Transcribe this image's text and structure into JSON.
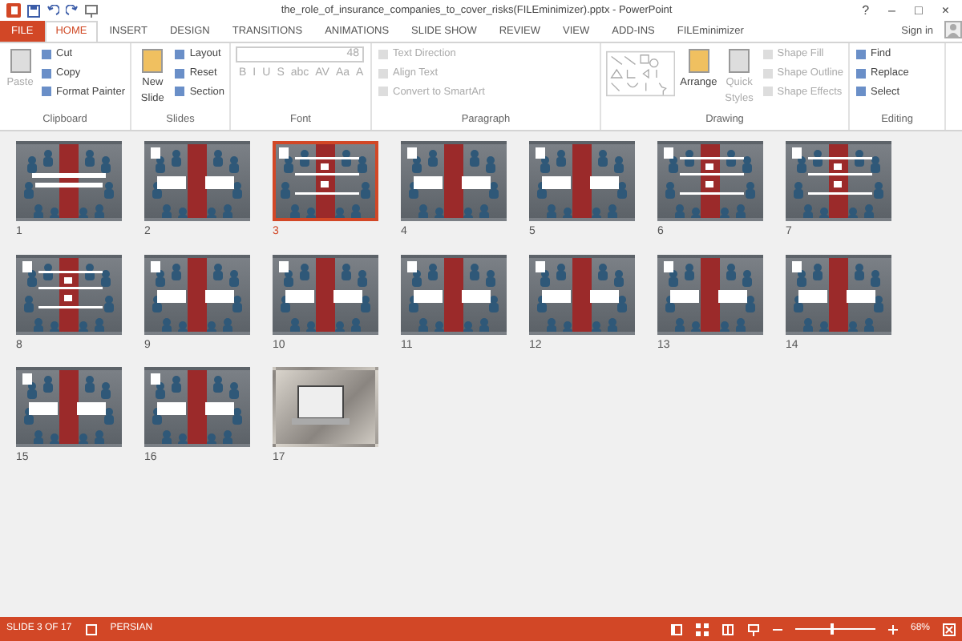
{
  "window": {
    "title": "the_role_of_insurance_companies_to_cover_risks(FILEminimizer).pptx - PowerPoint",
    "controls": [
      "?",
      "–",
      "□",
      "×"
    ]
  },
  "tabs": [
    {
      "label": "FILE",
      "kind": "file",
      "selected": false
    },
    {
      "label": "HOME",
      "kind": "tab",
      "selected": true
    },
    {
      "label": "INSERT",
      "kind": "tab",
      "selected": false
    },
    {
      "label": "DESIGN",
      "kind": "tab",
      "selected": false
    },
    {
      "label": "TRANSITIONS",
      "kind": "tab",
      "selected": false
    },
    {
      "label": "ANIMATIONS",
      "kind": "tab",
      "selected": false
    },
    {
      "label": "SLIDE SHOW",
      "kind": "tab",
      "selected": false
    },
    {
      "label": "REVIEW",
      "kind": "tab",
      "selected": false
    },
    {
      "label": "VIEW",
      "kind": "tab",
      "selected": false
    },
    {
      "label": "ADD-INS",
      "kind": "tab",
      "selected": false
    },
    {
      "label": "FILEminimizer",
      "kind": "tab",
      "selected": false
    }
  ],
  "sign_in": "Sign in",
  "ribbon": [
    {
      "label": "Clipboard",
      "items": [
        {
          "label": "Paste",
          "kind": "large",
          "disabled": true
        },
        {
          "label": "Cut",
          "kind": "small",
          "disabled": false
        },
        {
          "label": "Copy",
          "kind": "small",
          "disabled": false
        },
        {
          "label": "Format Painter",
          "kind": "small",
          "disabled": false
        }
      ]
    },
    {
      "label": "Slides",
      "items": [
        {
          "label": "New Slide",
          "kind": "large",
          "disabled": false
        },
        {
          "label": "Layout",
          "kind": "small",
          "disabled": false
        },
        {
          "label": "Reset",
          "kind": "small",
          "disabled": false
        },
        {
          "label": "Section",
          "kind": "small",
          "disabled": false
        }
      ]
    },
    {
      "label": "Font",
      "items": [
        {
          "label": "48",
          "kind": "fontsize",
          "disabled": true
        },
        {
          "label": "B",
          "kind": "glyph",
          "disabled": true
        },
        {
          "label": "I",
          "kind": "glyph",
          "disabled": true
        },
        {
          "label": "U",
          "kind": "glyph",
          "disabled": true
        },
        {
          "label": "S",
          "kind": "glyph",
          "disabled": true
        },
        {
          "label": "abc",
          "kind": "glyph",
          "disabled": true
        },
        {
          "label": "AV",
          "kind": "glyph",
          "disabled": true
        },
        {
          "label": "Aa",
          "kind": "glyph",
          "disabled": true
        },
        {
          "label": "A",
          "kind": "glyph",
          "disabled": true
        }
      ]
    },
    {
      "label": "Paragraph",
      "items": [
        {
          "label": "Text Direction",
          "kind": "small",
          "disabled": true
        },
        {
          "label": "Align Text",
          "kind": "small",
          "disabled": true
        },
        {
          "label": "Convert to SmartArt",
          "kind": "small",
          "disabled": true
        }
      ]
    },
    {
      "label": "Drawing",
      "items": [
        {
          "kind": "gallery",
          "disabled": true
        },
        {
          "label": "Arrange",
          "kind": "large",
          "disabled": false
        },
        {
          "label": "Quick Styles",
          "kind": "large",
          "disabled": true
        },
        {
          "label": "Shape Fill",
          "kind": "small",
          "disabled": true
        },
        {
          "label": "Shape Outline",
          "kind": "small",
          "disabled": true
        },
        {
          "label": "Shape Effects",
          "kind": "small",
          "disabled": true
        }
      ]
    },
    {
      "label": "Editing",
      "items": [
        {
          "label": "Find",
          "kind": "small",
          "disabled": false
        },
        {
          "label": "Replace",
          "kind": "small",
          "disabled": false
        },
        {
          "label": "Select",
          "kind": "small",
          "disabled": false
        }
      ]
    }
  ],
  "slides": [
    {
      "number": "1",
      "kind": "title",
      "selected": false
    },
    {
      "number": "2",
      "kind": "boxes",
      "selected": false
    },
    {
      "number": "3",
      "kind": "text",
      "selected": true
    },
    {
      "number": "4",
      "kind": "boxes",
      "selected": false
    },
    {
      "number": "5",
      "kind": "boxes",
      "selected": false
    },
    {
      "number": "6",
      "kind": "text",
      "selected": false
    },
    {
      "number": "7",
      "kind": "text",
      "selected": false
    },
    {
      "number": "8",
      "kind": "text",
      "selected": false
    },
    {
      "number": "9",
      "kind": "boxes",
      "selected": false
    },
    {
      "number": "10",
      "kind": "boxes",
      "selected": false
    },
    {
      "number": "11",
      "kind": "boxes",
      "selected": false
    },
    {
      "number": "12",
      "kind": "boxes",
      "selected": false
    },
    {
      "number": "13",
      "kind": "boxes",
      "selected": false
    },
    {
      "number": "14",
      "kind": "boxes",
      "selected": false
    },
    {
      "number": "15",
      "kind": "boxes",
      "selected": false
    },
    {
      "number": "16",
      "kind": "boxes",
      "selected": false
    },
    {
      "number": "17",
      "kind": "photo",
      "selected": false
    }
  ],
  "status_bar": {
    "slide_info": "SLIDE 3 OF 17",
    "language": "PERSIAN",
    "zoom": {
      "level": 0.45,
      "reading": "68%"
    }
  }
}
